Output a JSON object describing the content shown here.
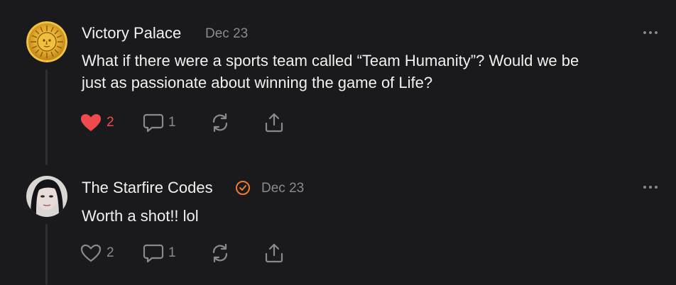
{
  "posts": [
    {
      "author": "Victory Palace",
      "date": "Dec 23",
      "body_lines": [
        "What if there were a sports team called “Team Humanity”? Would we be",
        "just as passionate about winning the game of Life?"
      ],
      "likes": "2",
      "liked": true,
      "comments": "1",
      "avatar_icon": "sun-emblem-icon",
      "verified": false
    },
    {
      "author": "The Starfire Codes",
      "date": "Dec 23",
      "body_lines": [
        "Worth a shot!! lol"
      ],
      "likes": "2",
      "liked": false,
      "comments": "1",
      "avatar_icon": "person-photo",
      "verified": true
    }
  ],
  "colors": {
    "background": "#1a1a1c",
    "text": "#f1f1f1",
    "muted": "#8a8a8e",
    "like_active": "#ef4b4f",
    "verified": "#f07b2f"
  }
}
